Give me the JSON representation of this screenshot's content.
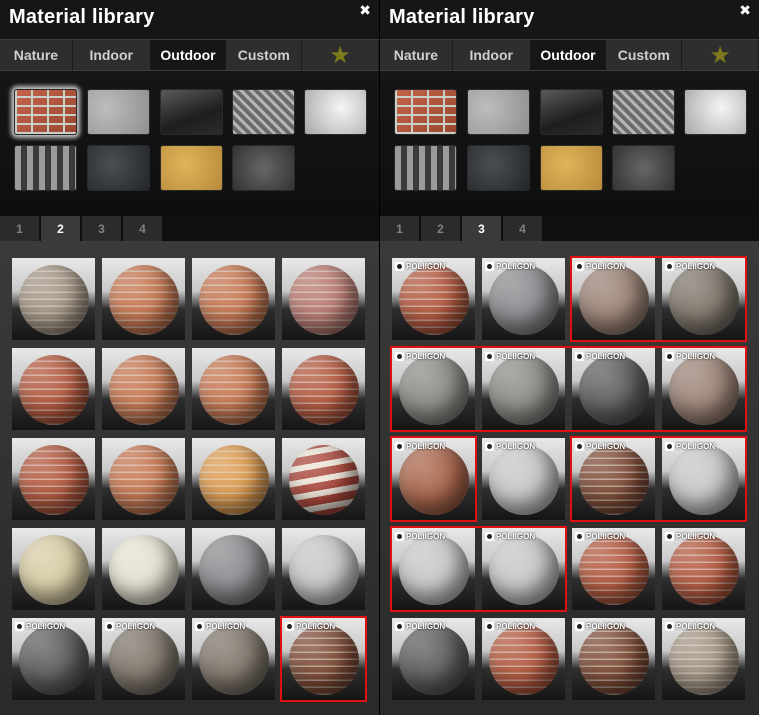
{
  "panels": [
    {
      "title": "Material library",
      "close_icon": "close-icon",
      "category_tabs": [
        "Nature",
        "Indoor",
        "Outdoor",
        "Custom"
      ],
      "active_category": "Outdoor",
      "favorites_icon": "star-icon",
      "page_tabs": [
        "1",
        "2",
        "3",
        "4"
      ],
      "active_page": "2",
      "thumbnails": [
        "brick",
        "concrete",
        "dark-glass",
        "diamond-plate",
        "white-plaster",
        "corrugated",
        "dark-granite",
        "cork",
        "asphalt"
      ],
      "selected_thumbnail": "brick",
      "rows": [
        [
          {
            "tex": "gray-brick"
          },
          {
            "tex": "orange-brick"
          },
          {
            "tex": "orange-brick"
          },
          {
            "tex": "pink-brick"
          }
        ],
        [
          {
            "tex": "red-brick"
          },
          {
            "tex": "orange-brick"
          },
          {
            "tex": "orange-brick"
          },
          {
            "tex": "red-brick"
          }
        ],
        [
          {
            "tex": "red-brick"
          },
          {
            "tex": "orange-brick"
          },
          {
            "tex": "yellow-brick"
          },
          {
            "tex": "striped-brick"
          }
        ],
        [
          {
            "tex": "cream-stone"
          },
          {
            "tex": "cream"
          },
          {
            "tex": "gray-paving"
          },
          {
            "tex": "white-paving"
          }
        ],
        [
          {
            "tex": "dark-cobble",
            "badge": "POLIIGON"
          },
          {
            "tex": "cobble",
            "badge": "POLIIGON"
          },
          {
            "tex": "cobble",
            "badge": "POLIIGON"
          },
          {
            "tex": "brown-brick",
            "badge": "POLIIGON"
          }
        ]
      ],
      "highlights": [
        {
          "r": 4,
          "c": 3,
          "w": 1,
          "h": 1
        }
      ]
    },
    {
      "title": "Material library",
      "close_icon": "close-icon",
      "category_tabs": [
        "Nature",
        "Indoor",
        "Outdoor",
        "Custom"
      ],
      "active_category": "Outdoor",
      "favorites_icon": "star-icon",
      "page_tabs": [
        "1",
        "2",
        "3",
        "4"
      ],
      "active_page": "3",
      "thumbnails": [
        "brick",
        "concrete",
        "dark-glass",
        "diamond-plate",
        "white-plaster",
        "corrugated",
        "dark-granite",
        "cork",
        "asphalt"
      ],
      "selected_thumbnail": "",
      "rows": [
        [
          {
            "tex": "red-brick",
            "badge": "POLIIGON"
          },
          {
            "tex": "gray-paving",
            "badge": "POLIIGON"
          },
          {
            "tex": "mixed-stone",
            "badge": "POLIIGON"
          },
          {
            "tex": "cobble",
            "badge": "POLIIGON"
          }
        ],
        [
          {
            "tex": "gray-cobble",
            "badge": "POLIIGON"
          },
          {
            "tex": "gray-cobble",
            "badge": "POLIIGON"
          },
          {
            "tex": "dark-cobble",
            "badge": "POLIIGON"
          },
          {
            "tex": "mixed-stone",
            "badge": "POLIIGON"
          }
        ],
        [
          {
            "tex": "orange-cobble",
            "badge": "POLIIGON"
          },
          {
            "tex": "white-paving",
            "badge": "POLIIGON"
          },
          {
            "tex": "brown-brick",
            "badge": "POLIIGON"
          },
          {
            "tex": "white-paving",
            "badge": "POLIIGON"
          }
        ],
        [
          {
            "tex": "white-paving",
            "badge": "POLIIGON"
          },
          {
            "tex": "white-paving",
            "badge": "POLIIGON"
          },
          {
            "tex": "red-brick",
            "badge": "POLIIGON"
          },
          {
            "tex": "red-brick",
            "badge": "POLIIGON"
          }
        ],
        [
          {
            "tex": "dark-cobble",
            "badge": "POLIIGON"
          },
          {
            "tex": "red-brick",
            "badge": "POLIIGON"
          },
          {
            "tex": "brown-brick",
            "badge": "POLIIGON"
          },
          {
            "tex": "gray-brick",
            "badge": "POLIIGON"
          }
        ]
      ],
      "highlights": [
        {
          "r": 0,
          "c": 2,
          "w": 2,
          "h": 1
        },
        {
          "r": 1,
          "c": 0,
          "w": 4,
          "h": 1
        },
        {
          "r": 2,
          "c": 0,
          "w": 1,
          "h": 1
        },
        {
          "r": 2,
          "c": 2,
          "w": 2,
          "h": 1
        },
        {
          "r": 3,
          "c": 0,
          "w": 2,
          "h": 1
        }
      ]
    }
  ],
  "colors": {
    "highlight": "#e01010",
    "star": "#7c7a1c",
    "tab_bar": "#2e2e2e"
  }
}
